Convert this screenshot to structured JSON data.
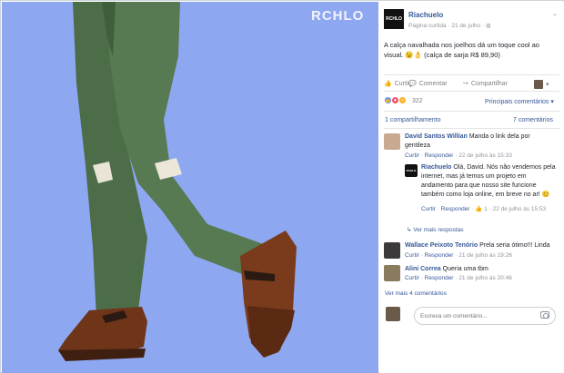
{
  "photo": {
    "watermark": "RCHLO"
  },
  "post": {
    "page_name": "Riachuelo",
    "page_logo": "RCHLO",
    "meta": "Página curtida · 21 de julho ·",
    "text": "A calça navalhada nos joelhos dá um toque cool ao visual. 😉👌 (calça de sarja R$ 89,90)"
  },
  "actions": {
    "like": "Curtir",
    "comment": "Comentar",
    "share": "Compartilhar"
  },
  "reactions": {
    "count": "322",
    "top_comments": "Principais comentários ▾"
  },
  "stats": {
    "shares": "1 compartilhamento",
    "comments": "7 comentários"
  },
  "comments": [
    {
      "author": "David Santos Willian",
      "text": "Manda o link dela por gentileza",
      "like": "Curtir",
      "reply": "Responder",
      "time": "22 de julho às 15:33"
    },
    {
      "author": "Riachuelo",
      "text": "Olá, David. Nós não vendemos pela internet, mas já temos um projeto em andamento para que nosso site funcione também como loja online, em breve no ar! 😊",
      "like": "Curtir",
      "reply": "Responder",
      "likes": "1",
      "time": "22 de julho às 15:53"
    },
    {
      "author": "Wallace Peixoto Tenório",
      "text": "Prela seria ótimo!!! Linda",
      "like": "Curtir",
      "reply": "Responder",
      "time": "21 de julho às 19:26"
    },
    {
      "author": "Alini Correa",
      "text": "Queria uma tbm",
      "like": "Curtir",
      "reply": "Responder",
      "time": "21 de julho às 20:46"
    }
  ],
  "more_replies": "Ver mais respostas",
  "more_comments": "Ver mais 4 comentários",
  "input": {
    "placeholder": "Escreva um comentário..."
  },
  "colors": {
    "link": "#365899",
    "photo_bg": "#8da6f0",
    "pants": "#4a6b46",
    "shoe": "#7a3b1c"
  }
}
